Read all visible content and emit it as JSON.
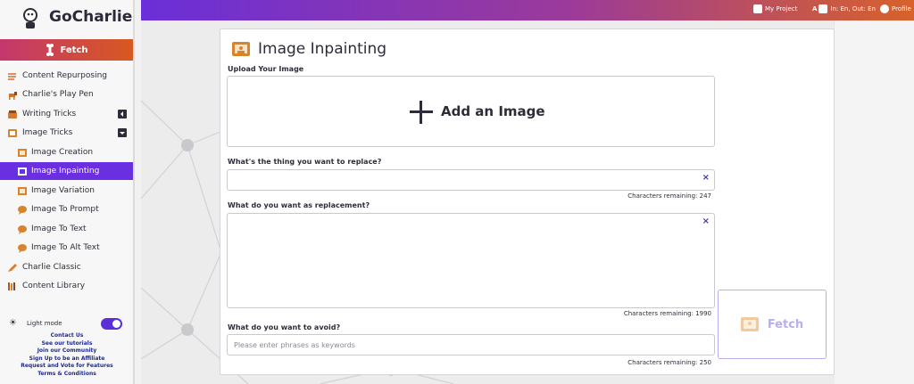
{
  "app": {
    "name": "GoCharlie"
  },
  "sidebar": {
    "fetch_label": "Fetch",
    "items": [
      {
        "label": "Content Repurposing",
        "icon": "repurpose-icon",
        "level": "top"
      },
      {
        "label": "Charlie's Play Pen",
        "icon": "dog-icon",
        "level": "top"
      },
      {
        "label": "Writing Tricks",
        "icon": "writing-icon",
        "level": "top",
        "caret": "collapsed"
      },
      {
        "label": "Image Tricks",
        "icon": "image-tricks-icon",
        "level": "top",
        "caret": "expanded"
      },
      {
        "label": "Image Creation",
        "icon": "image-creation-icon",
        "level": "sub"
      },
      {
        "label": "Image Inpainting",
        "icon": "image-inpainting-icon",
        "level": "sub",
        "active": true
      },
      {
        "label": "Image Variation",
        "icon": "image-variation-icon",
        "level": "sub"
      },
      {
        "label": "Image To Prompt",
        "icon": "image-to-prompt-icon",
        "level": "sub"
      },
      {
        "label": "Image To Text",
        "icon": "image-to-text-icon",
        "level": "sub"
      },
      {
        "label": "Image To Alt Text",
        "icon": "image-to-alt-text-icon",
        "level": "sub"
      },
      {
        "label": "Charlie Classic",
        "icon": "pencil-icon",
        "level": "top"
      },
      {
        "label": "Content Library",
        "icon": "library-icon",
        "level": "top"
      }
    ],
    "light_mode_label": "Light mode",
    "links": [
      "Contact Us",
      "See our tutorials",
      "Join our Community",
      "Sign Up to be an Affiliate",
      "Request and Vote for Features",
      "Terms & Conditions"
    ]
  },
  "topbar": {
    "project": "My Project",
    "language": "In: En, Out: En",
    "profile": "Profile"
  },
  "card": {
    "title": "Image Inpainting",
    "upload_label": "Upload Your Image",
    "add_image": "Add an Image",
    "replace_label": "What's the thing you want to replace?",
    "replace_counter": "Characters remaining: 247",
    "replacement_label": "What do you want as replacement?",
    "replacement_counter": "Characters remaining: 1990",
    "avoid_label": "What do you want to avoid?",
    "avoid_placeholder": "Please enter phrases as keywords",
    "avoid_counter": "Characters remaining: 250",
    "clear_symbol": "×",
    "fetch_button": "Fetch"
  },
  "colors": {
    "accent": "#6a2fe0",
    "fetch_gradient_start": "#c4376e",
    "fetch_gradient_end": "#d8591f"
  }
}
